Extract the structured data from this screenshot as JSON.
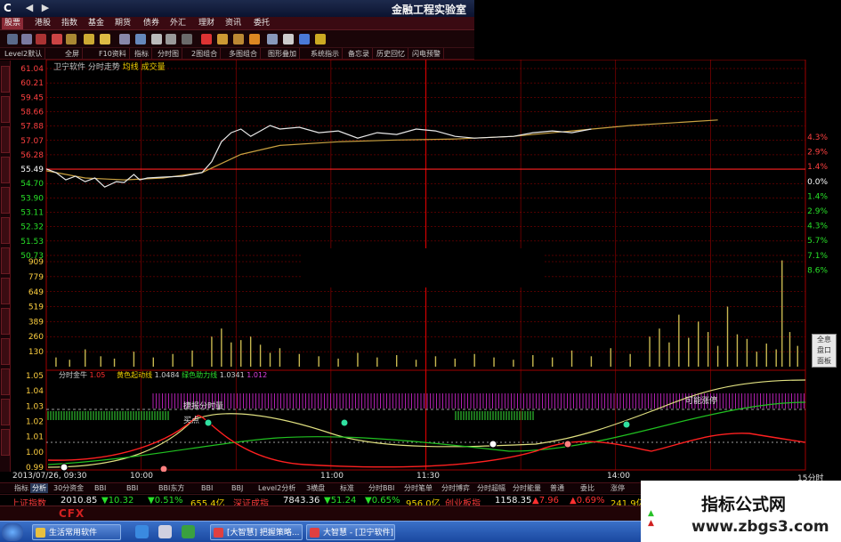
{
  "window": {
    "title": "金融工程实验室",
    "logo": "C"
  },
  "menu": [
    "股票",
    "港股",
    "指数",
    "基金",
    "期货",
    "债券",
    "外汇",
    "理财",
    "资讯",
    "委托"
  ],
  "subtoolbar": [
    "Level2默认",
    "全屏",
    "F10资料",
    "指标",
    "分时图",
    "2图组合",
    "多图组合",
    "图形叠加",
    "系统指示",
    "备忘录",
    "历史回忆",
    "闪电预警"
  ],
  "chart_header": {
    "stock": "卫宁软件 分时走势",
    "lines": "均线 成交量"
  },
  "price_axis": [
    "61.04",
    "60.21",
    "59.45",
    "58.66",
    "57.88",
    "57.07",
    "56.28",
    "55.49",
    "54.70",
    "53.90",
    "53.11",
    "52.32",
    "51.53",
    "50.73"
  ],
  "pct_axis": [
    "4.3%",
    "2.9%",
    "1.4%",
    "0.0%",
    "1.4%",
    "2.9%",
    "4.3%",
    "5.7%",
    "7.1%",
    "8.6%"
  ],
  "volume_axis": [
    "909",
    "779",
    "649",
    "519",
    "389",
    "260",
    "130"
  ],
  "indicator_axis": [
    "1.05",
    "1.04",
    "1.03",
    "1.02",
    "1.01",
    "1.00",
    "0.99"
  ],
  "indicator_legend": {
    "name": "分时金牛",
    "a_label": "1.05",
    "mid": "黄色起动线",
    "mid_val": "1.0484",
    "green_label": "绿色助力线",
    "green_val": "1.0341",
    "tail": "1.012"
  },
  "annotations": {
    "jiebao": "捷报分时量",
    "maidian": "买点",
    "kenengnuide": "可能涨停"
  },
  "sideflap": [
    "全息",
    "盘口",
    "面板"
  ],
  "time_axis": {
    "date": "2013/07/26, 09:30",
    "t1000": "10:00",
    "t1100": "11:00",
    "t1130": "11:30",
    "t1400": "14:00",
    "right": "15分时"
  },
  "bottom_tabs": [
    "指标",
    "分析",
    "30分资金",
    "BBI",
    "BBI",
    "BBI东方",
    "BBI",
    "BBJ",
    "Level2分析",
    "3横盘",
    "标准",
    "分时BBI",
    "分时笔单",
    "分时博弈",
    "分时超幅",
    "分时能量",
    "普通",
    "委比",
    "涨停",
    "主力"
  ],
  "ticker": {
    "sh_name": "上证指数",
    "sh_val": "2010.85",
    "sh_chg": "▼10.32",
    "sh_pct": "▼0.51%",
    "sh_amt": "655.4亿",
    "sz_name": "深证成指",
    "sz_val": "7843.36",
    "sz_chg": "▼51.24",
    "sz_pct": "▼0.65%",
    "sz_amt": "956.0亿",
    "cy_name": "创业板指",
    "cy_val": "1158.35",
    "cy_chg": "▲7.96",
    "cy_pct": "▲0.69%",
    "cy_amt": "241.9亿",
    "extra": "上证"
  },
  "statusbar": {
    "brand": "CFX"
  },
  "taskbar": [
    "生活常用软件",
    "[大智慧] 把握策略...",
    "大智慧 - [卫宁软件]"
  ],
  "watermark": {
    "line1": "指标公式网",
    "line2": "www.zbgs3.com"
  },
  "colors": {
    "grid": "#a00000",
    "price_line": "#e8e8e8",
    "avg_line": "#c8a040",
    "volume": "#c8b850",
    "green": "#2ee02e",
    "magenta": "#d030d0",
    "red": "#ff2020"
  },
  "chart_data": {
    "type": "line",
    "x_range": [
      "09:30",
      "15:00"
    ],
    "price_series": [
      {
        "t": 0,
        "v": 55.5
      },
      {
        "t": 5,
        "v": 55.3
      },
      {
        "t": 10,
        "v": 54.9
      },
      {
        "t": 15,
        "v": 55.1
      },
      {
        "t": 20,
        "v": 54.8
      },
      {
        "t": 25,
        "v": 55.0
      },
      {
        "t": 30,
        "v": 54.5
      },
      {
        "t": 36,
        "v": 54.8
      },
      {
        "t": 40,
        "v": 54.75
      },
      {
        "t": 45,
        "v": 55.2
      },
      {
        "t": 48,
        "v": 54.9
      },
      {
        "t": 52,
        "v": 55.0
      },
      {
        "t": 60,
        "v": 55.05
      },
      {
        "t": 70,
        "v": 55.1
      },
      {
        "t": 80,
        "v": 55.3
      },
      {
        "t": 85,
        "v": 55.9
      },
      {
        "t": 90,
        "v": 57.0
      },
      {
        "t": 95,
        "v": 57.5
      },
      {
        "t": 100,
        "v": 57.7
      },
      {
        "t": 105,
        "v": 57.3
      },
      {
        "t": 110,
        "v": 57.6
      },
      {
        "t": 115,
        "v": 57.9
      },
      {
        "t": 120,
        "v": 57.7
      },
      {
        "t": 130,
        "v": 57.8
      },
      {
        "t": 140,
        "v": 57.5
      },
      {
        "t": 150,
        "v": 57.6
      },
      {
        "t": 160,
        "v": 57.2
      },
      {
        "t": 170,
        "v": 57.5
      },
      {
        "t": 180,
        "v": 57.4
      },
      {
        "t": 190,
        "v": 57.7
      },
      {
        "t": 200,
        "v": 57.6
      },
      {
        "t": 210,
        "v": 57.3
      },
      {
        "t": 220,
        "v": 57.2
      },
      {
        "t": 230,
        "v": 57.25
      },
      {
        "t": 240,
        "v": 57.3
      },
      {
        "t": 250,
        "v": 57.5
      },
      {
        "t": 260,
        "v": 57.6
      },
      {
        "t": 270,
        "v": 57.5
      },
      {
        "t": 280,
        "v": 57.7
      }
    ],
    "avg_series": [
      {
        "t": 0,
        "v": 55.4
      },
      {
        "t": 20,
        "v": 55.0
      },
      {
        "t": 40,
        "v": 54.9
      },
      {
        "t": 60,
        "v": 55.0
      },
      {
        "t": 80,
        "v": 55.3
      },
      {
        "t": 100,
        "v": 56.3
      },
      {
        "t": 120,
        "v": 56.8
      },
      {
        "t": 150,
        "v": 57.0
      },
      {
        "t": 180,
        "v": 57.1
      },
      {
        "t": 210,
        "v": 57.15
      },
      {
        "t": 240,
        "v": 57.3
      },
      {
        "t": 270,
        "v": 57.6
      },
      {
        "t": 300,
        "v": 57.9
      },
      {
        "t": 330,
        "v": 58.1
      },
      {
        "t": 345,
        "v": 58.2
      }
    ],
    "volume": [
      {
        "t": 5,
        "v": 80
      },
      {
        "t": 12,
        "v": 60
      },
      {
        "t": 20,
        "v": 150
      },
      {
        "t": 28,
        "v": 90
      },
      {
        "t": 35,
        "v": 70
      },
      {
        "t": 45,
        "v": 130
      },
      {
        "t": 55,
        "v": 80
      },
      {
        "t": 65,
        "v": 110
      },
      {
        "t": 75,
        "v": 140
      },
      {
        "t": 85,
        "v": 260
      },
      {
        "t": 90,
        "v": 330
      },
      {
        "t": 95,
        "v": 210
      },
      {
        "t": 100,
        "v": 230
      },
      {
        "t": 105,
        "v": 260
      },
      {
        "t": 110,
        "v": 190
      },
      {
        "t": 115,
        "v": 120
      },
      {
        "t": 120,
        "v": 160
      },
      {
        "t": 130,
        "v": 110
      },
      {
        "t": 140,
        "v": 90
      },
      {
        "t": 150,
        "v": 70
      },
      {
        "t": 160,
        "v": 120
      },
      {
        "t": 170,
        "v": 80
      },
      {
        "t": 180,
        "v": 100
      },
      {
        "t": 190,
        "v": 60
      },
      {
        "t": 200,
        "v": 90
      },
      {
        "t": 210,
        "v": 70
      },
      {
        "t": 220,
        "v": 110
      },
      {
        "t": 230,
        "v": 80
      },
      {
        "t": 240,
        "v": 60
      },
      {
        "t": 250,
        "v": 100
      },
      {
        "t": 260,
        "v": 80
      },
      {
        "t": 270,
        "v": 140
      },
      {
        "t": 280,
        "v": 90
      },
      {
        "t": 290,
        "v": 160
      },
      {
        "t": 300,
        "v": 110
      },
      {
        "t": 310,
        "v": 260
      },
      {
        "t": 315,
        "v": 330
      },
      {
        "t": 320,
        "v": 210
      },
      {
        "t": 325,
        "v": 450
      },
      {
        "t": 330,
        "v": 250
      },
      {
        "t": 335,
        "v": 390
      },
      {
        "t": 340,
        "v": 300
      },
      {
        "t": 345,
        "v": 180
      },
      {
        "t": 350,
        "v": 520
      },
      {
        "t": 355,
        "v": 280
      },
      {
        "t": 360,
        "v": 240
      },
      {
        "t": 365,
        "v": 130
      },
      {
        "t": 370,
        "v": 200
      },
      {
        "t": 375,
        "v": 150
      },
      {
        "t": 378,
        "v": 920
      },
      {
        "t": 382,
        "v": 300
      },
      {
        "t": 386,
        "v": 180
      }
    ],
    "y_range_price": [
      50.73,
      61.04
    ],
    "y_range_volume": [
      0,
      909
    ]
  }
}
